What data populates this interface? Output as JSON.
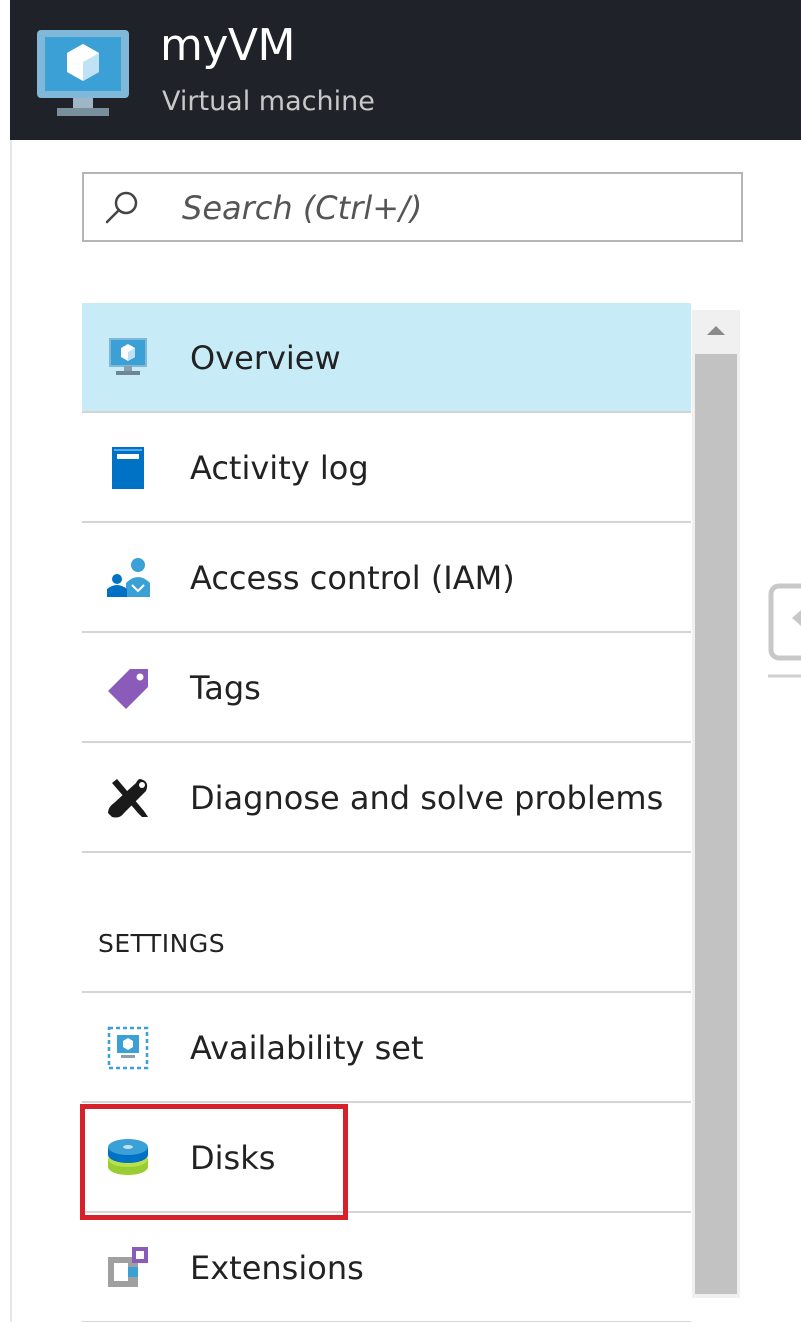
{
  "header": {
    "title": "myVM",
    "subtitle": "Virtual machine"
  },
  "search": {
    "placeholder": "Search (Ctrl+/)"
  },
  "menu": {
    "items": [
      {
        "label": "Overview",
        "icon": "vm-monitor-icon",
        "selected": true
      },
      {
        "label": "Activity log",
        "icon": "activity-log-icon"
      },
      {
        "label": "Access control (IAM)",
        "icon": "access-control-icon"
      },
      {
        "label": "Tags",
        "icon": "tag-icon"
      },
      {
        "label": "Diagnose and solve problems",
        "icon": "wrench-screwdriver-icon"
      }
    ],
    "settings_header": "SETTINGS",
    "settings_items": [
      {
        "label": "Availability set",
        "icon": "availability-set-icon"
      },
      {
        "label": "Disks",
        "icon": "disks-icon",
        "highlighted": true
      },
      {
        "label": "Extensions",
        "icon": "extensions-icon"
      }
    ]
  },
  "colors": {
    "header_bg": "#1f2329",
    "selected_bg": "#c7ecf7",
    "highlight_border": "#d6202a",
    "azure_blue": "#0072c6"
  }
}
